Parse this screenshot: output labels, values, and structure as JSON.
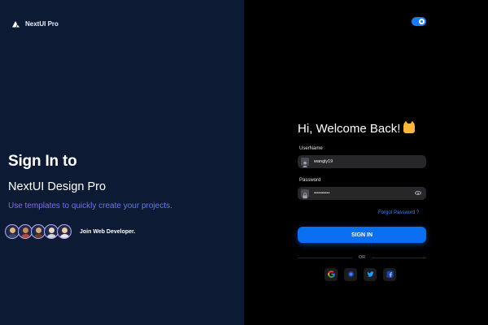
{
  "brand": {
    "name": "NextUI Pro",
    "logo_icon": "nextui-logo-icon"
  },
  "hero": {
    "line1": "Sign In to",
    "line2": "NextUI Design Pro",
    "tagline": "Use templates to quickly create your projects."
  },
  "community": {
    "avatars": [
      "avatar-1",
      "avatar-2",
      "avatar-3",
      "avatar-4",
      "avatar-5"
    ],
    "join_text": "Join Web Developer."
  },
  "theme_toggle": {
    "state": "dark",
    "accent": "#1c7cf3"
  },
  "form": {
    "heading": "Hi, Welcome Back!",
    "heading_emoji": "cat-emoji-icon",
    "username": {
      "label": "UserName",
      "value": "wangly19",
      "icon": "user-icon"
    },
    "password": {
      "label": "Password",
      "value": "••••••••••",
      "icon": "lock-icon",
      "toggle_icon": "eye-icon"
    },
    "forgot_link": "Forgot Password ?",
    "submit_label": "SIGN IN",
    "divider_text": "OR",
    "social_buttons": [
      "google-icon",
      "github-icon",
      "twitter-icon",
      "facebook-icon"
    ]
  },
  "colors": {
    "left_bg": "#0c1b33",
    "right_bg": "#000000",
    "primary": "#0a6ef0",
    "link": "#3b82f6",
    "field_bg": "#27272a"
  }
}
